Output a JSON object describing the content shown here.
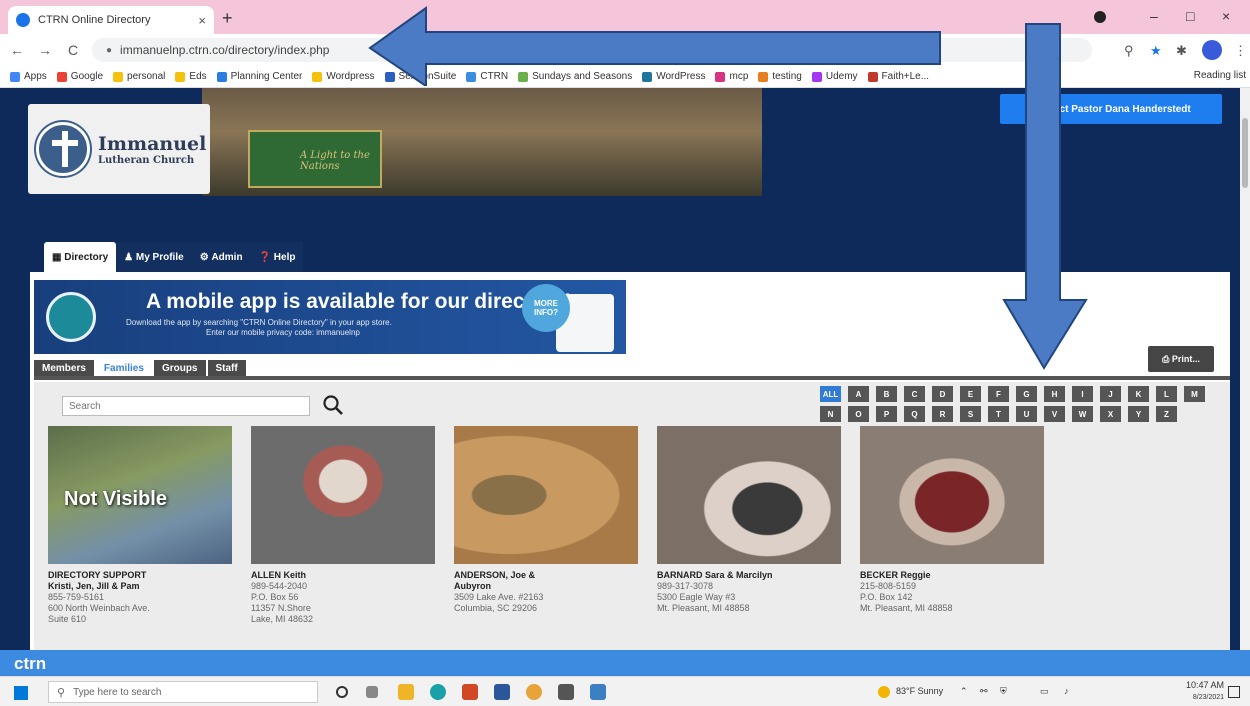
{
  "browser": {
    "tab_title": "CTRN Online Directory",
    "tab_close": "×",
    "new_tab": "+",
    "url": "immanuelnp.ctrn.co/directory/index.php",
    "back": "←",
    "forward": "→",
    "reload": "C",
    "window_min": "–",
    "window_max": "□",
    "window_close": "×",
    "reading_list": "Reading list",
    "bookmarks": [
      {
        "label": "Apps",
        "color": "#4285f4"
      },
      {
        "label": "Google",
        "color": "#ea4335"
      },
      {
        "label": "personal",
        "color": "#f4c20d"
      },
      {
        "label": "Eds",
        "color": "#f4c20d"
      },
      {
        "label": "Planning Center",
        "color": "#2a7de1"
      },
      {
        "label": "Wordpress",
        "color": "#f4c20d"
      },
      {
        "label": "SermonSuite",
        "color": "#2a5fbf"
      },
      {
        "label": "CTRN",
        "color": "#3a8ee0"
      },
      {
        "label": "Sundays and Seasons",
        "color": "#6ab04c"
      },
      {
        "label": "WordPress",
        "color": "#21759b"
      },
      {
        "label": "mcp",
        "color": "#d63384"
      },
      {
        "label": "testing",
        "color": "#e67e22"
      },
      {
        "label": "Udemy",
        "color": "#a435f0"
      },
      {
        "label": "Faith+Le...",
        "color": "#c0392b"
      }
    ]
  },
  "header": {
    "church_name_line1": "Immanuel",
    "church_name_line2": "Lutheran Church",
    "altar_text": "A Light to the Nations",
    "pastor_button": "Contact Pastor Dana Handerstedt"
  },
  "nav_tabs": [
    "Directory",
    "My Profile",
    "Admin",
    "Help"
  ],
  "app_banner": {
    "title": "A mobile app is available for our directory!",
    "line1": "Download the app by searching \"CTRN Online Directory\" in your app store.",
    "line2": "Enter our mobile privacy code:  immanuelnp",
    "more_info": "MORE INFO?"
  },
  "print_label": "Print...",
  "sub_tabs": [
    {
      "label": "Members",
      "active": false
    },
    {
      "label": "Families",
      "active": true
    },
    {
      "label": "Groups",
      "active": false
    },
    {
      "label": "Staff",
      "active": false
    }
  ],
  "search": {
    "placeholder": "Search"
  },
  "letters_row1": [
    "ALL",
    "A",
    "B",
    "C",
    "D",
    "E",
    "F",
    "G",
    "H",
    "I",
    "J",
    "K",
    "L",
    "M"
  ],
  "letters_row2": [
    "N",
    "O",
    "P",
    "Q",
    "R",
    "S",
    "T",
    "U",
    "V",
    "W",
    "X",
    "Y",
    "Z"
  ],
  "active_letter": "ALL",
  "not_visible_label": "Not Visible",
  "cards": [
    {
      "name1": "DIRECTORY SUPPORT",
      "name2": "Kristi, Jen, Jill & Pam",
      "lines": [
        "855-759-5161",
        "600 North Weinbach Ave.",
        "Suite 610"
      ]
    },
    {
      "name1": "ALLEN Keith",
      "name2": "",
      "lines": [
        "989-544-2040",
        "P.O. Box 56",
        "11357 N.Shore",
        "Lake, MI 48632"
      ]
    },
    {
      "name1": "ANDERSON, Joe &",
      "name2": "Aubyron",
      "lines": [
        "3509 Lake Ave. #2163",
        "Columbia, SC 29206"
      ]
    },
    {
      "name1": "BARNARD Sara & Marcilyn",
      "name2": "",
      "lines": [
        "989-317-3078",
        "5300 Eagle Way #3",
        "Mt. Pleasant, MI 48858"
      ]
    },
    {
      "name1": "BECKER Reggie",
      "name2": "",
      "lines": [
        "215-808-5159",
        "P.O. Box 142",
        "Mt. Pleasant, MI 48858"
      ]
    }
  ],
  "footer_logo": "ctrn",
  "taskbar": {
    "search_placeholder": "Type here to search",
    "weather": "83°F Sunny",
    "time": "10:47 AM",
    "date": "8/23/2021"
  },
  "colors": {
    "page_bg": "#0e2a5a",
    "accent_blue": "#1e7ef0",
    "arrow_fill": "#4a7bc4",
    "arrow_stroke": "#23457f"
  }
}
